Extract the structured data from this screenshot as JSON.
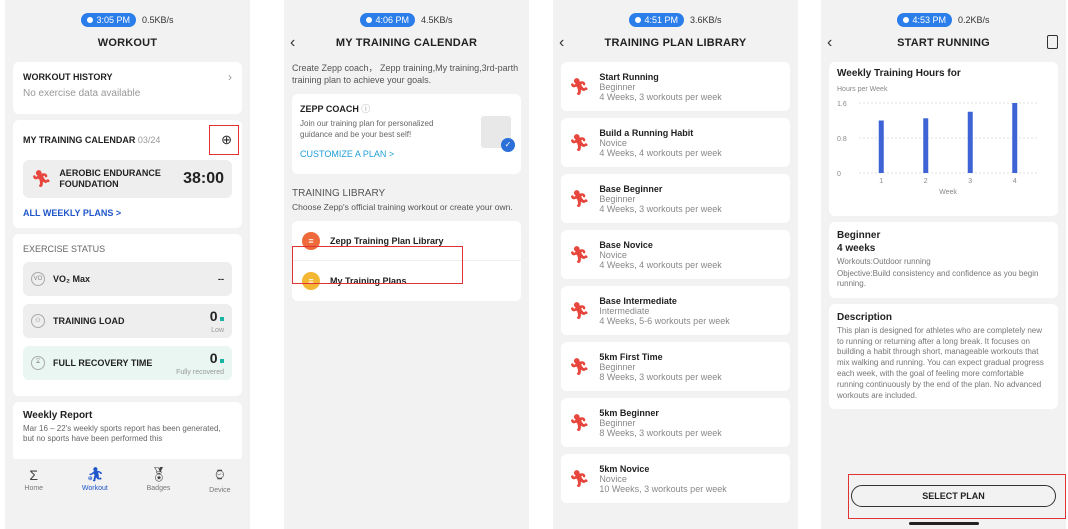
{
  "screen1": {
    "status_time": "3:05 PM",
    "status_info": "0.5KB/s",
    "title": "WORKOUT",
    "history_title": "WORKOUT HISTORY",
    "history_empty": "No exercise data available",
    "calendar_title": "MY TRAINING CALENDAR",
    "calendar_date": "03/24",
    "calendar_item_name": "AEROBIC ENDURANCE FOUNDATION",
    "calendar_item_time": "38:00",
    "all_plans_link": "ALL WEEKLY PLANS >",
    "exercise_status_title": "EXERCISE STATUS",
    "vo2_label": "VO₂ Max",
    "vo2_value": "--",
    "load_label": "TRAINING LOAD",
    "load_value": "0",
    "load_sub": "Low",
    "recovery_label": "FULL RECOVERY TIME",
    "recovery_value": "0",
    "recovery_sub": "Fully recovered",
    "weekly_title": "Weekly Report",
    "weekly_text": "Mar 16 – 22's weekly sports report has been generated, but no sports have been performed this",
    "tabs": [
      "Home",
      "Workout",
      "Badges",
      "Device"
    ]
  },
  "screen2": {
    "status_time": "4:06 PM",
    "status_info": "4.5KB/s",
    "title": "MY TRAINING CALENDAR",
    "intro": "Create Zepp coach， Zepp training,My training,3rd-parth training plan to achieve your goals.",
    "coach_title": "ZEPP COACH",
    "coach_text": "Join our training plan for personalized guidance and be your best self!",
    "customize_link": "CUSTOMIZE A PLAN >",
    "library_title": "TRAINING LIBRARY",
    "library_text": "Choose Zepp's official training workout or create your own.",
    "lib_item_1": "Zepp Training Plan Library",
    "lib_item_2": "My Training Plans"
  },
  "screen3": {
    "status_time": "4:51 PM",
    "status_info": "3.6KB/s",
    "title": "TRAINING PLAN LIBRARY",
    "plans": [
      {
        "name": "Start Running",
        "level": "Beginner",
        "detail": "4 Weeks, 3 workouts per week"
      },
      {
        "name": "Build a Running Habit",
        "level": "Novice",
        "detail": "4 Weeks, 4 workouts per week"
      },
      {
        "name": "Base Beginner",
        "level": "Beginner",
        "detail": "4 Weeks, 3 workouts per week"
      },
      {
        "name": "Base Novice",
        "level": "Novice",
        "detail": "4 Weeks, 4 workouts per week"
      },
      {
        "name": "Base Intermediate",
        "level": "Intermediate",
        "detail": "4 Weeks, 5-6 workouts per week"
      },
      {
        "name": "5km First Time",
        "level": "Beginner",
        "detail": "8 Weeks, 3 workouts per week"
      },
      {
        "name": "5km Beginner",
        "level": "Beginner",
        "detail": "8 Weeks, 3 workouts per week"
      },
      {
        "name": "5km Novice",
        "level": "Novice",
        "detail": "10 Weeks, 3 workouts per week"
      }
    ]
  },
  "screen4": {
    "status_time": "4:53 PM",
    "status_info": "0.2KB/s",
    "title": "START RUNNING",
    "chart_title": "Weekly Training Hours for",
    "level": "Beginner",
    "duration": "4 weeks",
    "workouts": "Workouts:Outdoor running",
    "objective": "Objective:Build consistency and confidence as you begin running.",
    "desc_title": "Description",
    "desc_text": "This plan is designed for athletes who are completely new to running or returning after a long break. It focuses on building a habit through short, manageable workouts that mix walking and running. You can expect gradual progress each week, with the goal of feeling more comfortable running continuously by the end of the plan. No advanced workouts are included.",
    "select_button": "SELECT PLAN"
  },
  "chart_data": {
    "type": "bar",
    "title": "Weekly Training Hours for",
    "ylabel": "Hours per Week",
    "xlabel": "Week",
    "categories": [
      "1",
      "2",
      "3",
      "4"
    ],
    "values": [
      1.2,
      1.25,
      1.4,
      1.6
    ],
    "ylim": [
      0,
      1.6
    ],
    "yticks": [
      0,
      0.8,
      1.6
    ],
    "color": "#3d63d6"
  }
}
